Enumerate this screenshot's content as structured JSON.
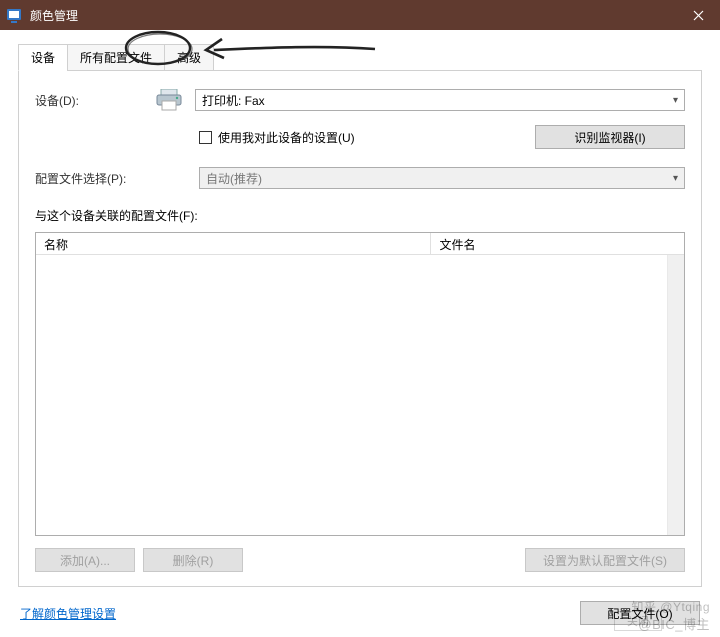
{
  "titlebar": {
    "title": "颜色管理"
  },
  "tabs": {
    "device": "设备",
    "all_profiles": "所有配置文件",
    "advanced": "高级"
  },
  "labels": {
    "device": "设备(D):",
    "profile_select": "配置文件选择(P):",
    "assoc_profiles": "与这个设备关联的配置文件(F):"
  },
  "device_select": {
    "value": "打印机: Fax"
  },
  "checkbox": {
    "label": "使用我对此设备的设置(U)"
  },
  "buttons": {
    "identify": "识别监视器(I)",
    "add": "添加(A)...",
    "remove": "删除(R)",
    "set_default": "设置为默认配置文件(S)",
    "profiles": "配置文件(O)",
    "close": "关闭"
  },
  "profile_mode": {
    "value": "自动(推荐)"
  },
  "columns": {
    "name": "名称",
    "filename": "文件名"
  },
  "link": {
    "label": "了解颜色管理设置"
  },
  "watermark": {
    "line1": "知乎 @Ytqing",
    "line2": "@BIC_博主"
  }
}
